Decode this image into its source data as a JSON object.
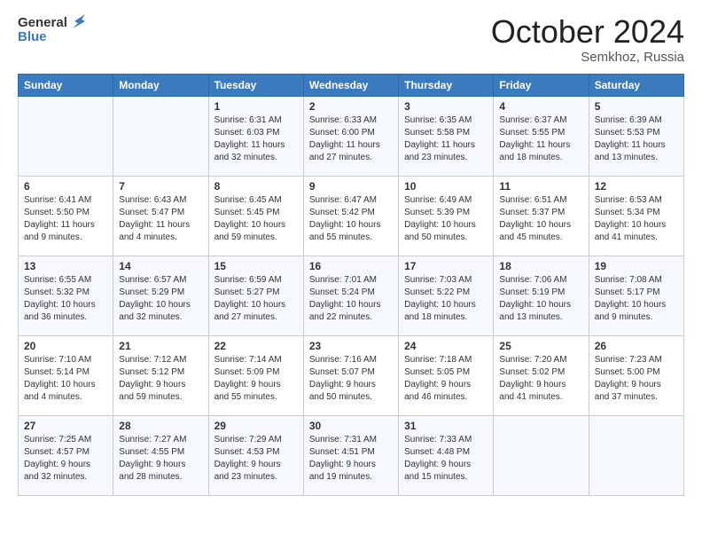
{
  "header": {
    "logo_line1": "General",
    "logo_line2": "Blue",
    "month": "October 2024",
    "location": "Semkhoz, Russia"
  },
  "days_of_week": [
    "Sunday",
    "Monday",
    "Tuesday",
    "Wednesday",
    "Thursday",
    "Friday",
    "Saturday"
  ],
  "weeks": [
    [
      {
        "day": "",
        "info": ""
      },
      {
        "day": "",
        "info": ""
      },
      {
        "day": "1",
        "info": "Sunrise: 6:31 AM\nSunset: 6:03 PM\nDaylight: 11 hours\nand 32 minutes."
      },
      {
        "day": "2",
        "info": "Sunrise: 6:33 AM\nSunset: 6:00 PM\nDaylight: 11 hours\nand 27 minutes."
      },
      {
        "day": "3",
        "info": "Sunrise: 6:35 AM\nSunset: 5:58 PM\nDaylight: 11 hours\nand 23 minutes."
      },
      {
        "day": "4",
        "info": "Sunrise: 6:37 AM\nSunset: 5:55 PM\nDaylight: 11 hours\nand 18 minutes."
      },
      {
        "day": "5",
        "info": "Sunrise: 6:39 AM\nSunset: 5:53 PM\nDaylight: 11 hours\nand 13 minutes."
      }
    ],
    [
      {
        "day": "6",
        "info": "Sunrise: 6:41 AM\nSunset: 5:50 PM\nDaylight: 11 hours\nand 9 minutes."
      },
      {
        "day": "7",
        "info": "Sunrise: 6:43 AM\nSunset: 5:47 PM\nDaylight: 11 hours\nand 4 minutes."
      },
      {
        "day": "8",
        "info": "Sunrise: 6:45 AM\nSunset: 5:45 PM\nDaylight: 10 hours\nand 59 minutes."
      },
      {
        "day": "9",
        "info": "Sunrise: 6:47 AM\nSunset: 5:42 PM\nDaylight: 10 hours\nand 55 minutes."
      },
      {
        "day": "10",
        "info": "Sunrise: 6:49 AM\nSunset: 5:39 PM\nDaylight: 10 hours\nand 50 minutes."
      },
      {
        "day": "11",
        "info": "Sunrise: 6:51 AM\nSunset: 5:37 PM\nDaylight: 10 hours\nand 45 minutes."
      },
      {
        "day": "12",
        "info": "Sunrise: 6:53 AM\nSunset: 5:34 PM\nDaylight: 10 hours\nand 41 minutes."
      }
    ],
    [
      {
        "day": "13",
        "info": "Sunrise: 6:55 AM\nSunset: 5:32 PM\nDaylight: 10 hours\nand 36 minutes."
      },
      {
        "day": "14",
        "info": "Sunrise: 6:57 AM\nSunset: 5:29 PM\nDaylight: 10 hours\nand 32 minutes."
      },
      {
        "day": "15",
        "info": "Sunrise: 6:59 AM\nSunset: 5:27 PM\nDaylight: 10 hours\nand 27 minutes."
      },
      {
        "day": "16",
        "info": "Sunrise: 7:01 AM\nSunset: 5:24 PM\nDaylight: 10 hours\nand 22 minutes."
      },
      {
        "day": "17",
        "info": "Sunrise: 7:03 AM\nSunset: 5:22 PM\nDaylight: 10 hours\nand 18 minutes."
      },
      {
        "day": "18",
        "info": "Sunrise: 7:06 AM\nSunset: 5:19 PM\nDaylight: 10 hours\nand 13 minutes."
      },
      {
        "day": "19",
        "info": "Sunrise: 7:08 AM\nSunset: 5:17 PM\nDaylight: 10 hours\nand 9 minutes."
      }
    ],
    [
      {
        "day": "20",
        "info": "Sunrise: 7:10 AM\nSunset: 5:14 PM\nDaylight: 10 hours\nand 4 minutes."
      },
      {
        "day": "21",
        "info": "Sunrise: 7:12 AM\nSunset: 5:12 PM\nDaylight: 9 hours\nand 59 minutes."
      },
      {
        "day": "22",
        "info": "Sunrise: 7:14 AM\nSunset: 5:09 PM\nDaylight: 9 hours\nand 55 minutes."
      },
      {
        "day": "23",
        "info": "Sunrise: 7:16 AM\nSunset: 5:07 PM\nDaylight: 9 hours\nand 50 minutes."
      },
      {
        "day": "24",
        "info": "Sunrise: 7:18 AM\nSunset: 5:05 PM\nDaylight: 9 hours\nand 46 minutes."
      },
      {
        "day": "25",
        "info": "Sunrise: 7:20 AM\nSunset: 5:02 PM\nDaylight: 9 hours\nand 41 minutes."
      },
      {
        "day": "26",
        "info": "Sunrise: 7:23 AM\nSunset: 5:00 PM\nDaylight: 9 hours\nand 37 minutes."
      }
    ],
    [
      {
        "day": "27",
        "info": "Sunrise: 7:25 AM\nSunset: 4:57 PM\nDaylight: 9 hours\nand 32 minutes."
      },
      {
        "day": "28",
        "info": "Sunrise: 7:27 AM\nSunset: 4:55 PM\nDaylight: 9 hours\nand 28 minutes."
      },
      {
        "day": "29",
        "info": "Sunrise: 7:29 AM\nSunset: 4:53 PM\nDaylight: 9 hours\nand 23 minutes."
      },
      {
        "day": "30",
        "info": "Sunrise: 7:31 AM\nSunset: 4:51 PM\nDaylight: 9 hours\nand 19 minutes."
      },
      {
        "day": "31",
        "info": "Sunrise: 7:33 AM\nSunset: 4:48 PM\nDaylight: 9 hours\nand 15 minutes."
      },
      {
        "day": "",
        "info": ""
      },
      {
        "day": "",
        "info": ""
      }
    ]
  ]
}
